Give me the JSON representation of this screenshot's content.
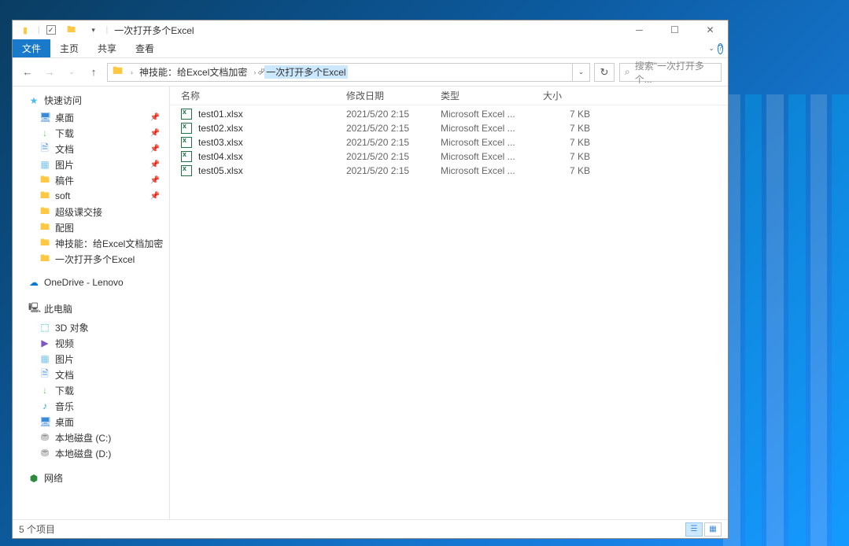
{
  "title": "一次打开多个Excel",
  "ribbon": {
    "file": "文件",
    "home": "主页",
    "share": "共享",
    "view": "查看"
  },
  "breadcrumb": {
    "item1": "神技能：给Excel文档加密",
    "item2": "一次打开多个Excel"
  },
  "search_placeholder": "搜索\"一次打开多个...",
  "nav": {
    "quick_access": "快速访问",
    "desktop": "桌面",
    "downloads": "下载",
    "documents": "文档",
    "pictures": "图片",
    "draft": "稿件",
    "soft": "soft",
    "super_handover": "超级课交接",
    "pictu": "配图",
    "skill_excel": "神技能：给Excel文档加密",
    "open_multi": "一次打开多个Excel",
    "onedrive": "OneDrive - Lenovo",
    "this_pc": "此电脑",
    "threed": "3D 对象",
    "videos": "视频",
    "pictures2": "图片",
    "documents2": "文档",
    "downloads2": "下载",
    "music": "音乐",
    "desktop2": "桌面",
    "drive_c": "本地磁盘 (C:)",
    "drive_d": "本地磁盘 (D:)",
    "network": "网络"
  },
  "columns": {
    "name": "名称",
    "date": "修改日期",
    "type": "类型",
    "size": "大小"
  },
  "files": [
    {
      "name": "test01.xlsx",
      "date": "2021/5/20 2:15",
      "type": "Microsoft Excel ...",
      "size": "7 KB"
    },
    {
      "name": "test02.xlsx",
      "date": "2021/5/20 2:15",
      "type": "Microsoft Excel ...",
      "size": "7 KB"
    },
    {
      "name": "test03.xlsx",
      "date": "2021/5/20 2:15",
      "type": "Microsoft Excel ...",
      "size": "7 KB"
    },
    {
      "name": "test04.xlsx",
      "date": "2021/5/20 2:15",
      "type": "Microsoft Excel ...",
      "size": "7 KB"
    },
    {
      "name": "test05.xlsx",
      "date": "2021/5/20 2:15",
      "type": "Microsoft Excel ...",
      "size": "7 KB"
    }
  ],
  "status": "5 个项目"
}
